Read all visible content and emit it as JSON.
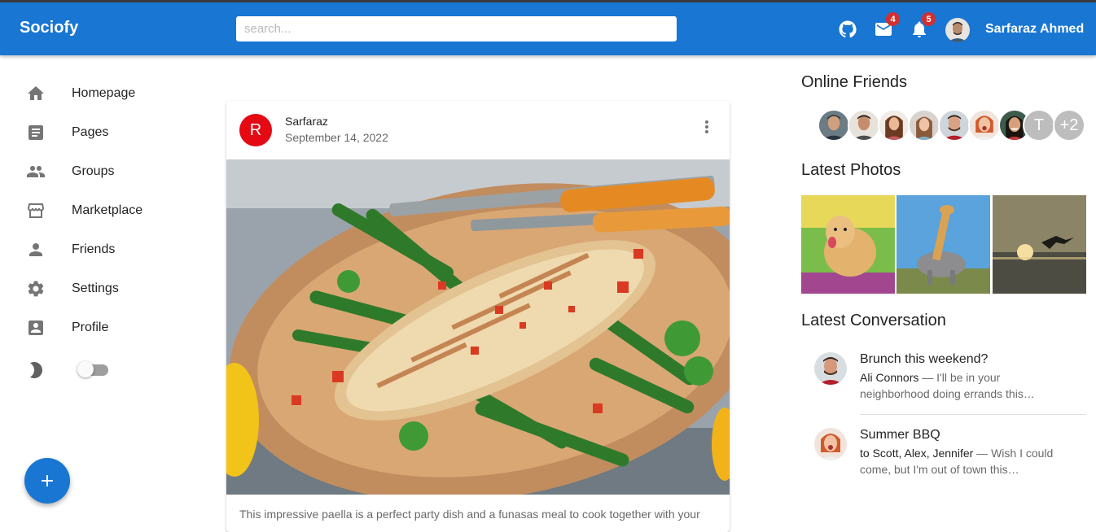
{
  "app": {
    "brand": "Sociofy",
    "search_placeholder": "search...",
    "mail_count": "4",
    "notification_count": "5",
    "user_name": "Sarfaraz Ahmed",
    "accent": "#1976d2",
    "badge_color": "#d32f2f"
  },
  "sidebar": {
    "items": [
      {
        "label": "Homepage",
        "icon": "home-icon"
      },
      {
        "label": "Pages",
        "icon": "article-icon"
      },
      {
        "label": "Groups",
        "icon": "group-icon"
      },
      {
        "label": "Marketplace",
        "icon": "storefront-icon"
      },
      {
        "label": "Friends",
        "icon": "person-icon"
      },
      {
        "label": "Settings",
        "icon": "settings-icon"
      },
      {
        "label": "Profile",
        "icon": "account-box-icon"
      }
    ],
    "dark_mode_enabled": false
  },
  "post": {
    "avatar_letter": "R",
    "author": "Sarfaraz",
    "date": "September 14, 2022",
    "text": "This impressive paella is a perfect party dish and a funasas meal to cook together with your"
  },
  "right": {
    "online_friends_title": "Online Friends",
    "extra_initial": "T",
    "extra_count": "+2",
    "latest_photos_title": "Latest Photos",
    "latest_conversation_title": "Latest Conversation",
    "conversations": [
      {
        "title": "Brunch this weekend?",
        "sender": "Ali Connors",
        "message": " — I'll be in your neighborhood doing errands this…"
      },
      {
        "title": "Summer BBQ",
        "sender": "to Scott, Alex, Jennifer",
        "message": " — Wish I could come, but I'm out of town this…"
      }
    ]
  }
}
